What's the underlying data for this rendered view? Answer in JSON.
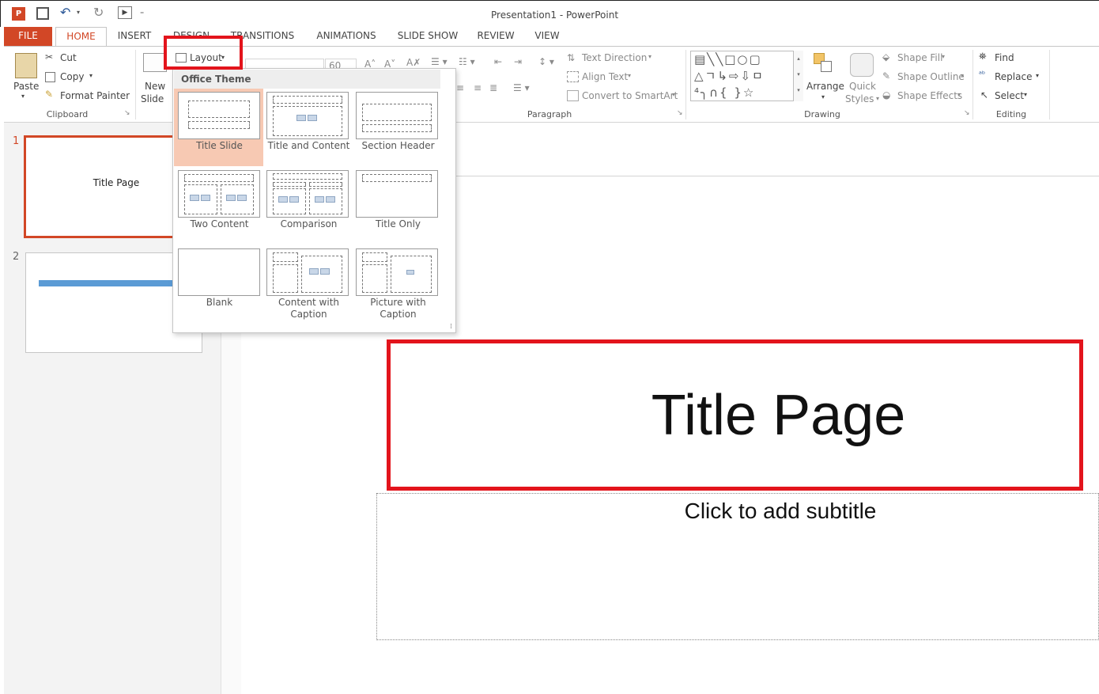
{
  "window": {
    "title": "Presentation1 - PowerPoint"
  },
  "tabs": [
    {
      "label": "FILE"
    },
    {
      "label": "HOME"
    },
    {
      "label": "INSERT"
    },
    {
      "label": "DESIGN"
    },
    {
      "label": "TRANSITIONS"
    },
    {
      "label": "ANIMATIONS"
    },
    {
      "label": "SLIDE SHOW"
    },
    {
      "label": "REVIEW"
    },
    {
      "label": "VIEW"
    }
  ],
  "clipboard": {
    "paste": "Paste",
    "cut": "Cut",
    "copy": "Copy",
    "format_painter": "Format Painter",
    "label": "Clipboard"
  },
  "slides_group": {
    "new_slide_1": "New",
    "new_slide_2": "Slide",
    "layout": "Layout"
  },
  "font": {
    "size": "60"
  },
  "paragraph": {
    "text_direction": "Text Direction",
    "align_text": "Align Text",
    "convert_smartart": "Convert to SmartArt",
    "label": "Paragraph"
  },
  "drawing": {
    "arrange": "Arrange",
    "quick_styles_1": "Quick",
    "quick_styles_2": "Styles",
    "shape_fill": "Shape Fill",
    "shape_outline": "Shape Outline",
    "shape_effects": "Shape Effects",
    "label": "Drawing"
  },
  "editing": {
    "find": "Find",
    "replace": "Replace",
    "select": "Select",
    "label": "Editing"
  },
  "layout_menu": {
    "header": "Office Theme",
    "items": [
      {
        "label": "Title Slide"
      },
      {
        "label": "Title and Content"
      },
      {
        "label": "Section Header"
      },
      {
        "label": "Two Content"
      },
      {
        "label": "Comparison"
      },
      {
        "label": "Title Only"
      },
      {
        "label": "Blank"
      },
      {
        "label_1": "Content with",
        "label_2": "Caption"
      },
      {
        "label_1": "Picture with",
        "label_2": "Caption"
      }
    ]
  },
  "thumbnails": [
    {
      "number": "1",
      "text": "Title Page"
    },
    {
      "number": "2"
    }
  ],
  "slide": {
    "title": "Title Page",
    "subtitle_placeholder": "Click to add subtitle"
  },
  "colors": {
    "accent": "#d24726",
    "highlight": "#e3141c",
    "selected_layout": "#f7c9b3"
  }
}
